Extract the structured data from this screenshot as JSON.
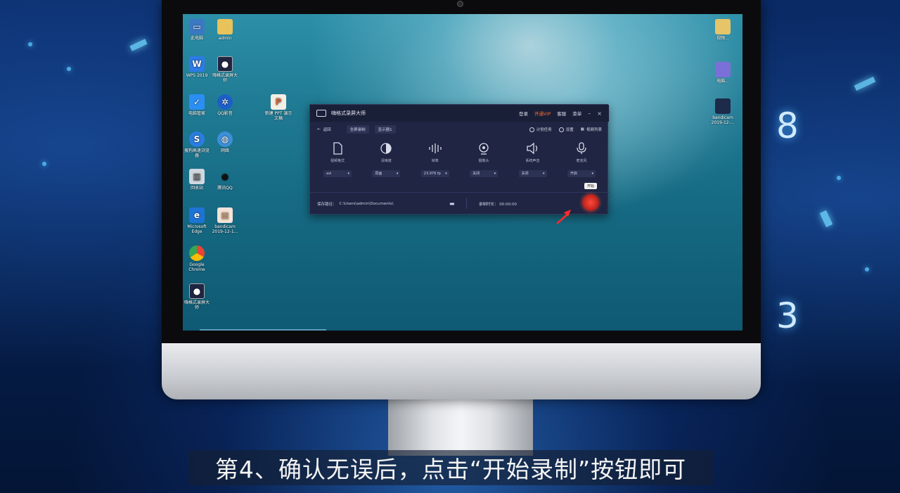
{
  "background": {
    "number_top": "8",
    "number_bottom": "3"
  },
  "desktop_icons": [
    {
      "label": "此电脑"
    },
    {
      "label": "admin"
    },
    {
      "label": "WPS 2019"
    },
    {
      "label": "嗨格式录屏大师"
    },
    {
      "label": "电脑管家"
    },
    {
      "label": "QQ影音"
    },
    {
      "label": "新建 PPT 演示文稿"
    },
    {
      "label": "搜狗高速浏览器"
    },
    {
      "label": "网络"
    },
    {
      "label": "回收站"
    },
    {
      "label": "腾讯QQ"
    },
    {
      "label": "Microsoft Edge"
    },
    {
      "label": "bandicam 2019-12-1..."
    },
    {
      "label": "Google Chrome"
    },
    {
      "label": "嗨格式录屏大师"
    }
  ],
  "right_icons": [
    {
      "label": "视频..."
    },
    {
      "label": "电脑..."
    },
    {
      "label": "bandicam 2019-12-..."
    }
  ],
  "app": {
    "title": "嗨格式录屏大师",
    "menu": {
      "login": "登录",
      "vip": "开通VIP",
      "service": "客服",
      "more": "菜单"
    },
    "window_controls": {
      "minimize": "–",
      "close": "×"
    },
    "toolbar": {
      "back": "返回",
      "mode": "全屏录制",
      "display": "显示器1",
      "schedule": "计划任务",
      "settings": "设置",
      "video_list": "视频列表"
    },
    "options": [
      {
        "icon": "file-icon",
        "label": "视频格式",
        "value": "avi"
      },
      {
        "icon": "contrast-icon",
        "label": "清晰度",
        "value": "原画"
      },
      {
        "icon": "waveform-icon",
        "label": "帧率",
        "value": "23.976 fp"
      },
      {
        "icon": "camera-icon",
        "label": "摄像头",
        "value": "关闭"
      },
      {
        "icon": "speaker-icon",
        "label": "系统声音",
        "value": "关闭"
      },
      {
        "icon": "mic-icon",
        "label": "麦克风",
        "value": "开启"
      }
    ],
    "bottom": {
      "save_path_label": "保存路径：",
      "save_path": "C:\\Users\\admin\\Documents\\",
      "record_time_label": "录制时长：",
      "record_time": "00:00:00"
    },
    "tooltip": "开始"
  },
  "subtitle": "第4、确认无误后，点击“开始录制”按钮即可"
}
